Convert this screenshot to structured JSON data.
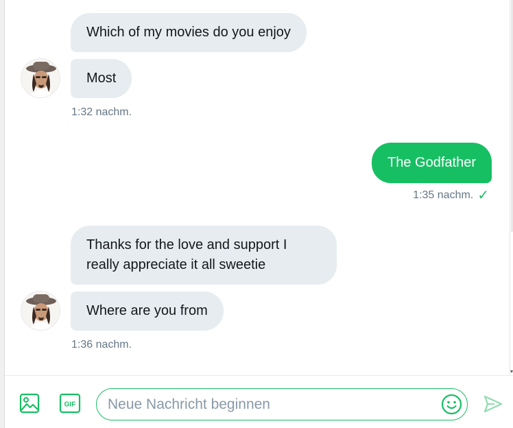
{
  "conversation": {
    "messages": [
      {
        "from": "them",
        "text": "Which of my movies do you enjoy"
      },
      {
        "from": "them",
        "text": "Most"
      },
      {
        "from": "me",
        "text": "The Godfather"
      },
      {
        "from": "them",
        "text": "Thanks for the love and support I really appreciate it all sweetie"
      },
      {
        "from": "them",
        "text": "Where are you from"
      }
    ],
    "timestamps": {
      "group1": "1:32 nachm.",
      "group2": "1:35 nachm.",
      "group3": "1:36 nachm."
    },
    "sent_check": "✓"
  },
  "composer": {
    "placeholder": "Neue Nachricht beginnen",
    "gif_label": "GIF"
  },
  "colors": {
    "accent": "#17bf63",
    "incoming_bubble": "#e6ecf0",
    "timestamp": "#657786"
  },
  "icons": [
    "avatar",
    "image-icon",
    "gif-icon",
    "emoji-icon",
    "send-icon",
    "check-icon"
  ]
}
